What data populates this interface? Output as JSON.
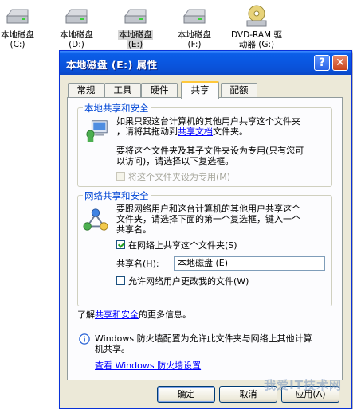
{
  "desktop": {
    "drives": [
      {
        "line1": "本地磁盘",
        "line2": "(C:)"
      },
      {
        "line1": "本地磁盘",
        "line2": "(D:)"
      },
      {
        "line1": "本地磁盘",
        "line2": "(E:)"
      },
      {
        "line1": "本地磁盘",
        "line2": "(F:)"
      },
      {
        "line1": "DVD-RAM 驱",
        "line2": "动器 (G:)"
      }
    ]
  },
  "dialog": {
    "title": "本地磁盘 (E:) 属性",
    "help_glyph": "?",
    "close_glyph": "✕",
    "tabs": [
      "常规",
      "工具",
      "硬件",
      "共享",
      "配额"
    ],
    "active_tab": "共享",
    "local_group": {
      "title": "本地共享和安全",
      "para1_a": "如果只跟这台计算机的其他用户共享这个文件夹",
      "para1_b_pre": "，请将其拖动到",
      "para1_b_link": "共享文档",
      "para1_b_post": "文件夹。",
      "para2_a": "要将这个文件夹及其子文件夹设为专用(只有您可",
      "para2_b": "以访问)，请选择以下复选框。",
      "private_checkbox": "将这个文件夹设为专用(M)"
    },
    "network_group": {
      "title": "网络共享和安全",
      "para_a": "要跟网络用户和这台计算机的其他用户共享这个",
      "para_b": "文件夹，请选择下面的第一个复选框，键入一个",
      "para_c": "共享名。",
      "share_checkbox": "在网络上共享这个文件夹(S)",
      "share_name_label": "共享名(H):",
      "share_name_value": "本地磁盘 (E)",
      "allow_change_checkbox": "允许网络用户更改我的文件(W)",
      "learn_pre": "了解",
      "learn_link": "共享和安全",
      "learn_post": "的更多信息。"
    },
    "firewall": {
      "text_a": "Windows 防火墙配置为允许此文件夹与网络上其他计算",
      "text_b": "机共享。",
      "link": "查看 Windows 防火墙设置"
    },
    "buttons": {
      "ok": "确定",
      "cancel": "取消",
      "apply": "应用(A)"
    }
  },
  "watermark": "我爱IT技术网"
}
